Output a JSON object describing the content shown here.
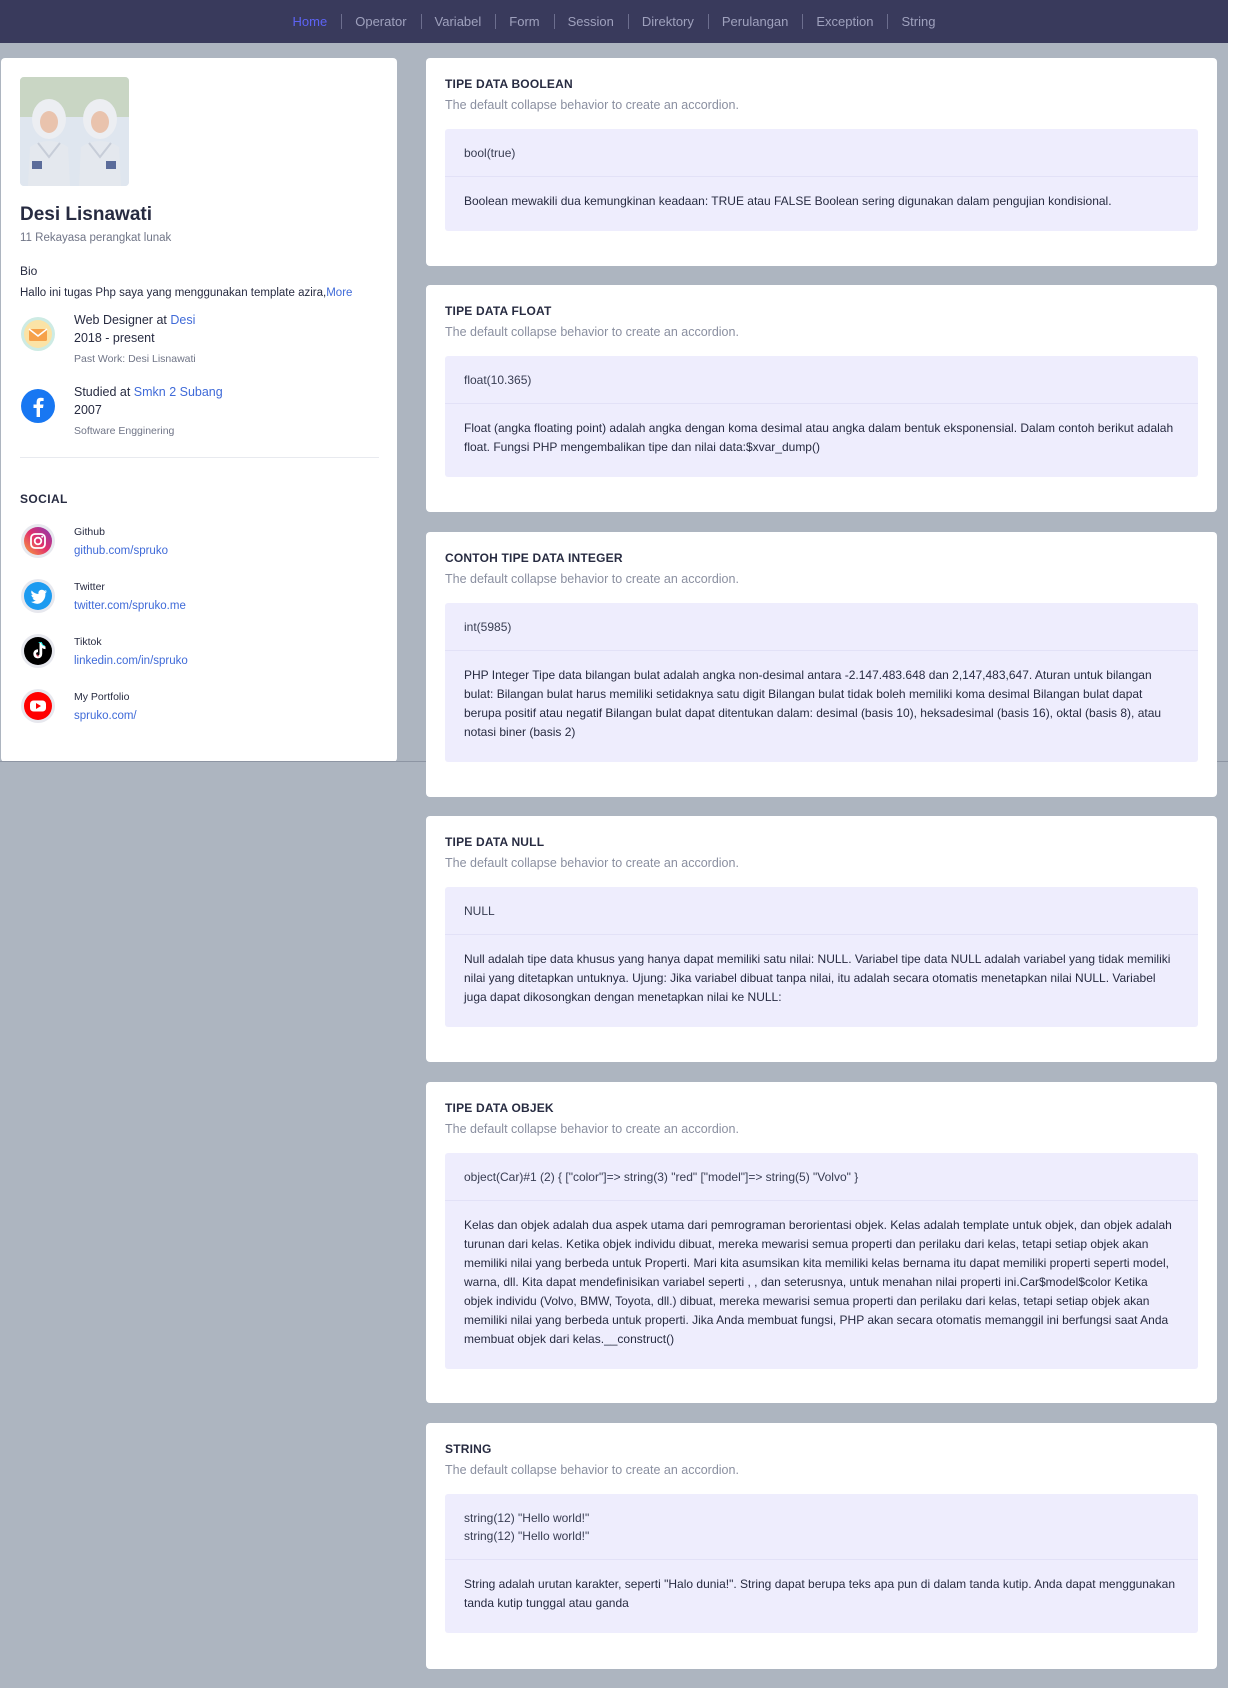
{
  "nav": {
    "items": [
      "Home",
      "Operator",
      "Variabel",
      "Form",
      "Session",
      "Direktory",
      "Perulangan",
      "Exception",
      "String"
    ]
  },
  "profile": {
    "name": "Desi Lisnawati",
    "role": "11 Rekayasa perangkat lunak",
    "bio_label": "Bio",
    "bio_text": "Hallo ini tugas Php saya yang menggunakan template azira,",
    "bio_more": "More",
    "experience": [
      {
        "icon": "mail-icon",
        "prefix": "Web Designer at ",
        "org": "Desi",
        "period": "2018 - present",
        "note": "Past Work: Desi Lisnawati"
      },
      {
        "icon": "facebook-icon",
        "prefix": "Studied at ",
        "org": "Smkn 2 Subang",
        "period": "2007",
        "note": "Software Engginering"
      }
    ],
    "social_title": "SOCIAL",
    "social": [
      {
        "icon": "instagram-icon",
        "label": "Github",
        "value": "github.com/spruko"
      },
      {
        "icon": "twitter-icon",
        "label": "Twitter",
        "value": "twitter.com/spruko.me"
      },
      {
        "icon": "tiktok-icon",
        "label": "Tiktok",
        "value": "linkedin.com/in/spruko"
      },
      {
        "icon": "youtube-icon",
        "label": "My Portfolio",
        "value": "spruko.com/"
      }
    ]
  },
  "cards": [
    {
      "title": "TIPE DATA BOOLEAN",
      "subtitle": "The default collapse behavior to create an accordion.",
      "head": "bool(true)",
      "body": "Boolean mewakili dua kemungkinan keadaan: TRUE atau FALSE Boolean sering digunakan dalam pengujian kondisional."
    },
    {
      "title": "TIPE DATA FLOAT",
      "subtitle": "The default collapse behavior to create an accordion.",
      "head": "float(10.365)",
      "body": "Float (angka floating point) adalah angka dengan koma desimal atau angka dalam bentuk eksponensial. Dalam contoh berikut adalah float. Fungsi PHP mengembalikan tipe dan nilai data:$xvar_dump()"
    },
    {
      "title": "CONTOH TIPE DATA INTEGER",
      "subtitle": "The default collapse behavior to create an accordion.",
      "head": "int(5985)",
      "body": "PHP Integer Tipe data bilangan bulat adalah angka non-desimal antara -2.147.483.648 dan 2,147,483,647. Aturan untuk bilangan bulat: Bilangan bulat harus memiliki setidaknya satu digit Bilangan bulat tidak boleh memiliki koma desimal Bilangan bulat dapat berupa positif atau negatif Bilangan bulat dapat ditentukan dalam: desimal (basis 10), heksadesimal (basis 16), oktal (basis 8), atau notasi biner (basis 2)"
    },
    {
      "title": "TIPE DATA NULL",
      "subtitle": "The default collapse behavior to create an accordion.",
      "head": "NULL",
      "body": "Null adalah tipe data khusus yang hanya dapat memiliki satu nilai: NULL. Variabel tipe data NULL adalah variabel yang tidak memiliki nilai yang ditetapkan untuknya. Ujung: Jika variabel dibuat tanpa nilai, itu adalah secara otomatis menetapkan nilai NULL. Variabel juga dapat dikosongkan dengan menetapkan nilai ke NULL:"
    },
    {
      "title": "TIPE DATA OBJEK",
      "subtitle": "The default collapse behavior to create an accordion.",
      "head": "object(Car)#1 (2) { [\"color\"]=> string(3) \"red\" [\"model\"]=> string(5) \"Volvo\" }",
      "body": "Kelas dan objek adalah dua aspek utama dari pemrograman berorientasi objek. Kelas adalah template untuk objek, dan objek adalah turunan dari kelas. Ketika objek individu dibuat, mereka mewarisi semua properti dan perilaku dari kelas, tetapi setiap objek akan memiliki nilai yang berbeda untuk Properti. Mari kita asumsikan kita memiliki kelas bernama itu dapat memiliki properti seperti model, warna, dll. Kita dapat mendefinisikan variabel seperti , , dan seterusnya, untuk menahan nilai properti ini.Car$model$color Ketika objek individu (Volvo, BMW, Toyota, dll.) dibuat, mereka mewarisi semua properti dan perilaku dari kelas, tetapi setiap objek akan memiliki nilai yang berbeda untuk properti. Jika Anda membuat fungsi, PHP akan secara otomatis memanggil ini berfungsi saat Anda membuat objek dari kelas.__construct()"
    },
    {
      "title": "STRING",
      "subtitle": "The default collapse behavior to create an accordion.",
      "head": "string(12) \"Hello world!\"\nstring(12) \"Hello world!\"",
      "body": "String adalah urutan karakter, seperti \"Halo dunia!\". String dapat berupa teks apa pun di dalam tanda kutip. Anda dapat menggunakan tanda kutip tunggal atau ganda"
    }
  ]
}
